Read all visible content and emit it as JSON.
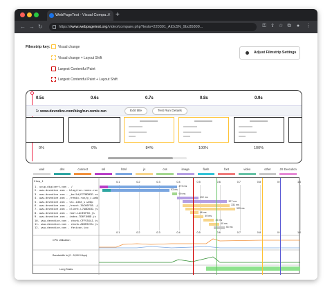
{
  "browser": {
    "tab_title": "WebPageTest - Visual Compa...",
    "url_host": "www.webpagetest.org",
    "url_prefix": "https://",
    "url_path": "/video/compare.php?tests=220301_AiDc5N_9bc85809...",
    "traffic_colors": [
      "#ff5f57",
      "#febc2e",
      "#28c840"
    ]
  },
  "filmstrip_key": {
    "label": "Filmstrip key:",
    "items": [
      {
        "label": "Visual change",
        "color": "#ffc233",
        "style": "solid"
      },
      {
        "label": "Visual change + Layout Shift",
        "color": "#ffc233",
        "style": "dashed"
      },
      {
        "label": "Largest Contentful Paint",
        "color": "#d00000",
        "style": "solid"
      },
      {
        "label": "Largest Contentful Paint + Layout Shift",
        "color": "#d00000",
        "style": "dashed"
      }
    ]
  },
  "adjust_button": "Adjust Filmstrip Settings",
  "filmstrip": {
    "ticks": [
      "0.5s",
      "0.6s",
      "0.7s",
      "0.8s",
      "0.9s"
    ],
    "url_label": "1: www.devndive.com/blog/run-remix-run",
    "edit_title": "Edit title",
    "test_run_details": "Test Run Details",
    "frames": [
      {
        "percent": "0%",
        "state": "blank"
      },
      {
        "percent": "0%",
        "state": "blank"
      },
      {
        "percent": "84%",
        "state": "visual-change"
      },
      {
        "percent": "100%",
        "state": "visual-change"
      },
      {
        "percent": "100%",
        "state": "complete"
      }
    ]
  },
  "waterfall": {
    "legend": [
      {
        "label": "wait",
        "color": "#d7d7d7"
      },
      {
        "label": "dns",
        "color": "#2da5a1"
      },
      {
        "label": "connect",
        "color": "#f2913b"
      },
      {
        "label": "ssl",
        "color": "#b93ec7"
      },
      {
        "label": "html",
        "color": "#7aa6e0"
      },
      {
        "label": "js",
        "color": "#f7d58a"
      },
      {
        "label": "css",
        "color": "#a3d78f"
      },
      {
        "label": "image",
        "color": "#b49ee3"
      },
      {
        "label": "flash",
        "color": "#32c3d7"
      },
      {
        "label": "font",
        "color": "#f07a7a"
      },
      {
        "label": "video",
        "color": "#66c2a5"
      },
      {
        "label": "other",
        "color": "#c7c7c7"
      },
      {
        "label": "JS Execution",
        "color": "#e78ad6"
      }
    ],
    "step_label": "Step_1",
    "time_labels": [
      "0.1",
      "0.2",
      "0.3",
      "0.4",
      "0.5",
      "0.6",
      "0.7",
      "0.8",
      "0.9",
      "1.0"
    ],
    "rows": [
      {
        "label": "1. ucup.digicert.com - /",
        "ms": "273 ms"
      },
      {
        "label": "2. www.devndive.com - blog/run-remix-run",
        "ms": "93 ms"
      },
      {
        "label": "3. www.devndive.com - _build/E7FBDB3E.css",
        "ms": "90 ms"
      },
      {
        "label": "4. www.devndive.com - /remix-run/g_i.webp",
        "ms": "192 ms"
      },
      {
        "label": "5. www.devndive.com - ssl-idea_s.webp",
        "ms": "327 ms"
      },
      {
        "label": "6. www.devndive.com - /react-3AC66F58..js",
        "ms": "331 ms"
      },
      {
        "label": "7. www.devndive.com - client-L7A8D03D.js",
        "ms": "303 ms"
      },
      {
        "label": "8. www.devndive.com - root-LACE5F56.js",
        "ms": "46 ms"
      },
      {
        "label": "9. www.devndive.com - index-7D6F1N8D.js",
        "ms": "49 ms"
      },
      {
        "label": "10. www.devndive.com - chunk-CFFV3X4J.js",
        "ms": "42 ms"
      },
      {
        "label": "11. www.devndive.com - chunk-A6SR5CVU.js",
        "ms": "40 ms"
      },
      {
        "label": "12. www.devndive.com - favicon.ico",
        "ms": "46 ms"
      }
    ],
    "cpu_label": "CPU Utilization",
    "bandwidth_label": "Bandwidth In (0 - 5,000 Kbps)",
    "long_tasks_label": "Long Tasks"
  }
}
